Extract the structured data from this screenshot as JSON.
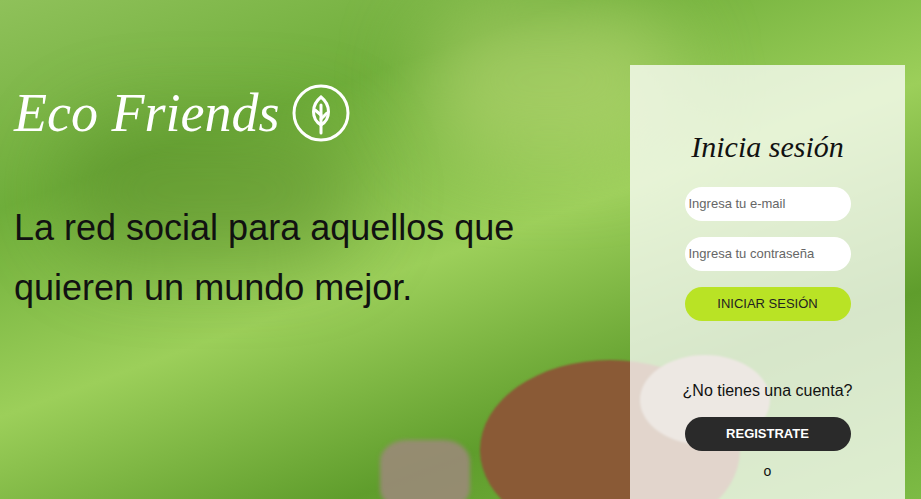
{
  "brand": {
    "name": "Eco Friends"
  },
  "tagline": "La red social para aquellos que quieren un mundo mejor.",
  "login": {
    "title": "Inicia sesión",
    "email": {
      "placeholder": "Ingresa tu e-mail"
    },
    "password": {
      "placeholder": "Ingresa tu contraseña"
    },
    "submit": "INICIAR SESIÓN",
    "signup_prompt": "¿No tienes una cuenta?",
    "signup": "REGISTRATE",
    "divider": "o"
  }
}
